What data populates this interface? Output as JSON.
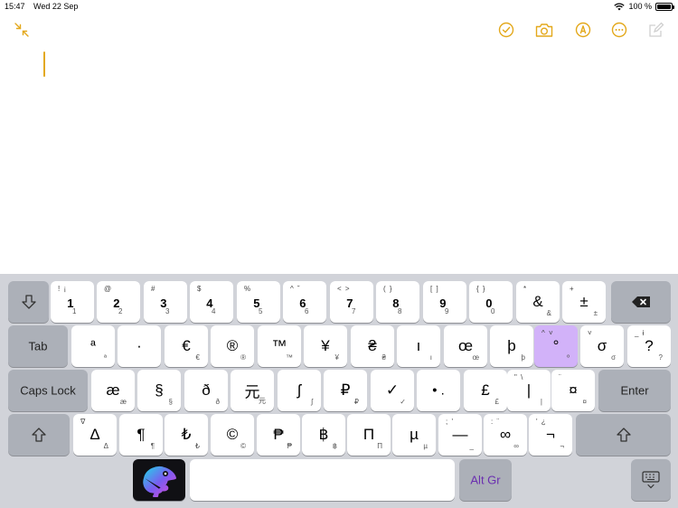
{
  "status": {
    "time": "15:47",
    "date": "Wed 22 Sep",
    "battery": "100 %"
  },
  "colors": {
    "accent": "#e3a81b",
    "keyboard_bg": "#d1d3d9",
    "key_bg": "#ffffff",
    "fn_key_bg": "#acb0b8",
    "selected_key_bg": "#d2b2f9",
    "altgr_text": "#6b2fb0"
  },
  "toolbar": {
    "icons": [
      "collapse-arrows-icon",
      "checklist-icon",
      "camera-icon",
      "markup-pen-icon",
      "more-icon",
      "compose-icon"
    ]
  },
  "keyboard": {
    "row1": {
      "keys": [
        {
          "shift": "! ¡",
          "main": "1",
          "sub": "1"
        },
        {
          "shift": "@",
          "main": "2",
          "sub": "2"
        },
        {
          "shift": "#",
          "main": "3",
          "sub": "3"
        },
        {
          "shift": "$",
          "main": "4",
          "sub": "4"
        },
        {
          "shift": "%",
          "main": "5",
          "sub": "5"
        },
        {
          "shift": "^ ˘",
          "main": "6",
          "sub": "6"
        },
        {
          "shift": "< >",
          "main": "7",
          "sub": "7"
        },
        {
          "shift": "( }",
          "main": "8",
          "sub": "8"
        },
        {
          "shift": "[ ]",
          "main": "9",
          "sub": "9"
        },
        {
          "shift": "{ }",
          "main": "0",
          "sub": "0"
        },
        {
          "shift": "*",
          "main": "&",
          "sub": "&"
        },
        {
          "shift": "+",
          "main": "±",
          "sub": "±"
        }
      ]
    },
    "row2": {
      "tab_label": "Tab",
      "keys": [
        {
          "shift": "",
          "main": "ª",
          "sub": "ª"
        },
        {
          "shift": "",
          "main": "·",
          "sub": ""
        },
        {
          "shift": "",
          "main": "€",
          "sub": "€"
        },
        {
          "shift": "",
          "main": "®",
          "sub": "®"
        },
        {
          "shift": "",
          "main": "™",
          "sub": "™"
        },
        {
          "shift": "",
          "main": "¥",
          "sub": "¥"
        },
        {
          "shift": "",
          "main": "₴",
          "sub": "₴"
        },
        {
          "shift": "",
          "main": "ı",
          "sub": "ı"
        },
        {
          "shift": "",
          "main": "œ",
          "sub": "œ"
        },
        {
          "shift": "",
          "main": "þ",
          "sub": "þ"
        },
        {
          "shift": "^ ˅",
          "main": "°",
          "sub": "º"
        },
        {
          "shift": "˅",
          "main": "σ",
          "sub": "σ"
        },
        {
          "shift": "_ ɨ",
          "main": "?",
          "sub": "?"
        }
      ]
    },
    "row3": {
      "caps_label": "Caps Lock",
      "enter_label": "Enter",
      "keys": [
        {
          "shift": "",
          "main": "æ",
          "sub": "æ"
        },
        {
          "shift": "",
          "main": "§",
          "sub": "§"
        },
        {
          "shift": "",
          "main": "ð",
          "sub": "ð"
        },
        {
          "shift": "",
          "main": "元",
          "sub": "元"
        },
        {
          "shift": "",
          "main": "ʃ",
          "sub": "ʃ"
        },
        {
          "shift": "",
          "main": "₽",
          "sub": "₽"
        },
        {
          "shift": "",
          "main": "✓",
          "sub": "✓"
        },
        {
          "shift": "",
          "main": "• .",
          "sub": ""
        },
        {
          "shift": "",
          "main": "£",
          "sub": "£"
        },
        {
          "shift": "\" \\",
          "main": "|",
          "sub": "|"
        },
        {
          "shift": "¨",
          "main": "¤",
          "sub": "¤"
        }
      ]
    },
    "row4": {
      "keys": [
        {
          "shift": "∇",
          "main": "Δ",
          "sub": "Δ"
        },
        {
          "shift": "",
          "main": "¶",
          "sub": "¶"
        },
        {
          "shift": "",
          "main": "₺",
          "sub": "₺"
        },
        {
          "shift": "",
          "main": "©",
          "sub": "©"
        },
        {
          "shift": "",
          "main": "₱",
          "sub": "₱"
        },
        {
          "shift": "",
          "main": "฿",
          "sub": "฿"
        },
        {
          "shift": "",
          "main": "Π",
          "sub": "Π"
        },
        {
          "shift": "",
          "main": "µ",
          "sub": "µ"
        },
        {
          "shift": "; '",
          "main": "—",
          "sub": "_"
        },
        {
          "shift": ": ¨",
          "main": "∞",
          "sub": "∞"
        },
        {
          "shift": "' ¿",
          "main": "¬",
          "sub": "¬"
        }
      ]
    },
    "row5": {
      "altgr_label": "Alt Gr"
    }
  }
}
